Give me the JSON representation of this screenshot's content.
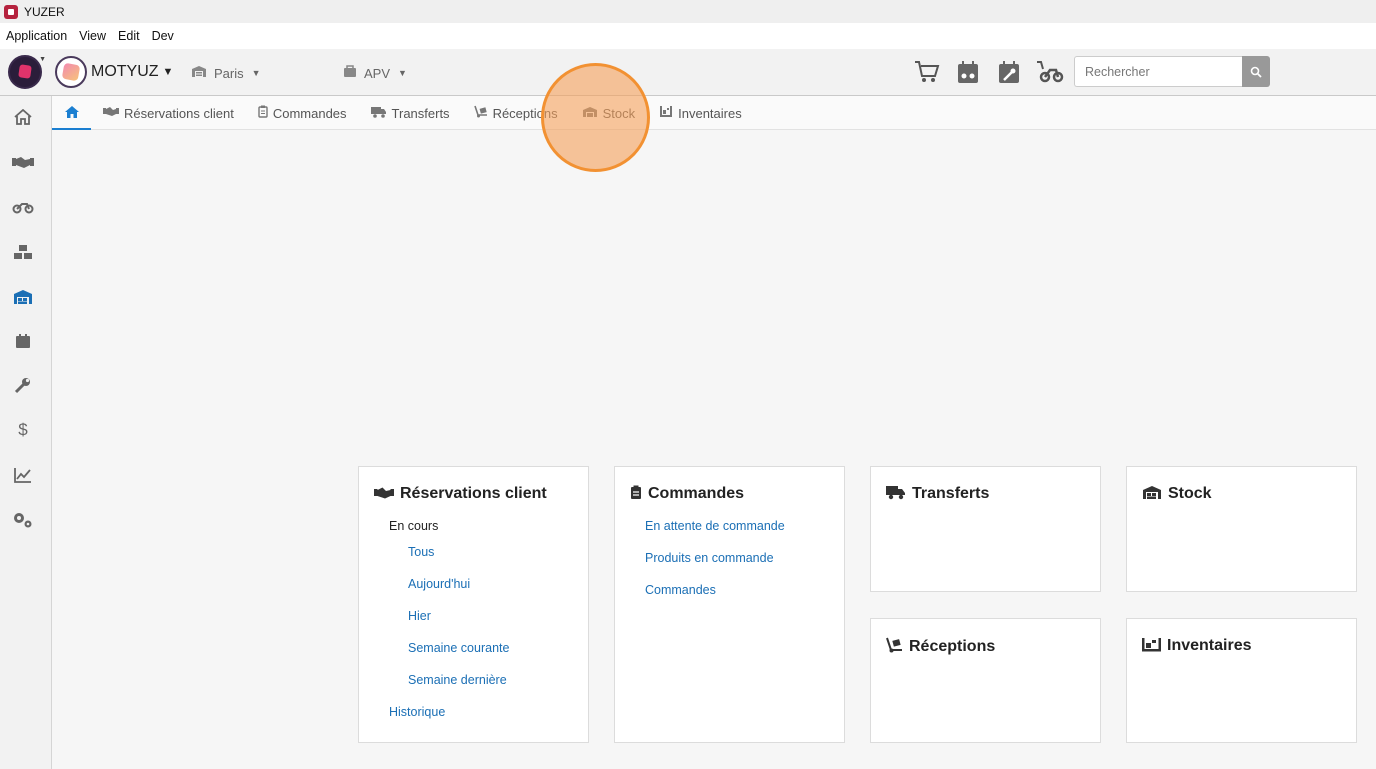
{
  "window": {
    "title": "YUZER"
  },
  "menu": [
    "Application",
    "View",
    "Edit",
    "Dev"
  ],
  "header": {
    "tenant_name": "MOTYUZ",
    "location_selector": "Paris",
    "department_selector": "APV",
    "quick_icons": [
      "cart-icon",
      "calendar-moto-icon",
      "calendar-wrench-icon",
      "cart-moto-icon"
    ],
    "search": {
      "placeholder": "Rechercher"
    }
  },
  "sidebar": {
    "items": [
      {
        "icon": "home-icon",
        "label": "home"
      },
      {
        "icon": "handshake-icon",
        "label": "reservations"
      },
      {
        "icon": "motorcycle-icon",
        "label": "vehicles"
      },
      {
        "icon": "boxes-icon",
        "label": "products"
      },
      {
        "icon": "warehouse-icon",
        "label": "stock",
        "active": true
      },
      {
        "icon": "calendar-icon",
        "label": "calendar"
      },
      {
        "icon": "wrench-icon",
        "label": "workshop"
      },
      {
        "icon": "dollar-icon",
        "label": "sales"
      },
      {
        "icon": "chart-line-icon",
        "label": "stats"
      },
      {
        "icon": "settings-icon",
        "label": "settings"
      }
    ]
  },
  "tabs": [
    {
      "label": "",
      "icon": "home-icon",
      "active": true
    },
    {
      "label": "Réservations client",
      "icon": "handshake-icon"
    },
    {
      "label": "Commandes",
      "icon": "clipboard-icon"
    },
    {
      "label": "Transferts",
      "icon": "truck-icon"
    },
    {
      "label": "Réceptions",
      "icon": "dolly-icon"
    },
    {
      "label": "Stock",
      "icon": "warehouse-icon"
    },
    {
      "label": "Inventaires",
      "icon": "inventory-icon"
    }
  ],
  "cards": {
    "reservations": {
      "title": "Réservations client",
      "section": "En cours",
      "links": [
        "Tous",
        "Aujourd'hui",
        "Hier",
        "Semaine courante",
        "Semaine dernière"
      ],
      "history": "Historique"
    },
    "commandes": {
      "title": "Commandes",
      "links": [
        "En attente de commande",
        "Produits en commande",
        "Commandes"
      ]
    },
    "transferts": {
      "title": "Transferts"
    },
    "stock": {
      "title": "Stock"
    },
    "receptions": {
      "title": "Réceptions"
    },
    "inventaires": {
      "title": "Inventaires"
    }
  }
}
